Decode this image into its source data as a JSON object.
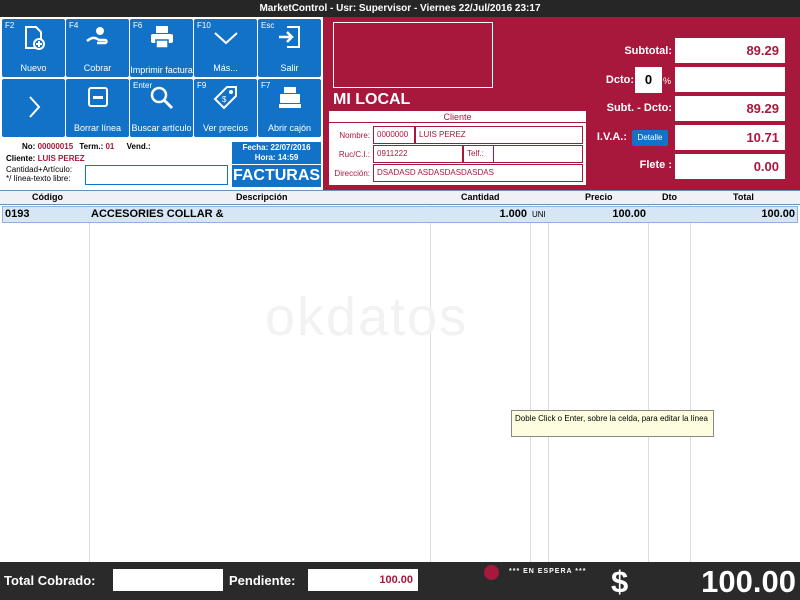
{
  "window": {
    "title": "MarketControl - Usr: Supervisor - Viernes 22/Jul/2016  23:17"
  },
  "toolbar": {
    "buttons": [
      {
        "fkey": "F2",
        "label": "Nuevo",
        "icon": "new-document-icon"
      },
      {
        "fkey": "F4",
        "label": "Cobrar",
        "icon": "hand-coin-icon"
      },
      {
        "fkey": "F6",
        "label": "Imprimir factura",
        "icon": "printer-icon"
      },
      {
        "fkey": "F10",
        "label": "Más...",
        "icon": "chevron-down-icon"
      },
      {
        "fkey": "Esc",
        "label": "Salir",
        "icon": "exit-icon"
      },
      {
        "fkey": "",
        "label": "",
        "icon": "chevron-right-icon"
      },
      {
        "fkey": "",
        "label": "Borrar línea",
        "icon": "delete-line-icon"
      },
      {
        "fkey": "Enter",
        "label": "Buscar artículo",
        "icon": "search-icon"
      },
      {
        "fkey": "F9",
        "label": "Ver precios",
        "icon": "price-tag-icon"
      },
      {
        "fkey": "F7",
        "label": "Abrir cajón",
        "icon": "cash-register-icon"
      }
    ]
  },
  "invoice": {
    "no_label": "No:",
    "no_value": "00000015",
    "term_label": "Term.:",
    "term_value": "01",
    "vend_label": "Vend.:",
    "cliente_label": "Cliente:",
    "cliente_value": "LUIS PEREZ",
    "cantidad_label": "Cantidad+Artículo:",
    "linea_label": "*/ línea-texto libre:",
    "fecha": "Fecha: 22/07/2016",
    "hora": "Hora: 14:59",
    "doc_type": "FACTURAS"
  },
  "store": {
    "name": "MI LOCAL"
  },
  "cliente": {
    "title": "Cliente",
    "nombre_label": "Nombre:",
    "codigo": "0000000",
    "nombre": "LUIS PEREZ",
    "ruc_label": "Ruc/C.I.:",
    "ruc": "0911222",
    "telf_label": "Telf.:",
    "telf": "",
    "direccion_label": "Dirección:",
    "direccion": "DSADASD ASDASDASDASDAS"
  },
  "totals": {
    "subtotal_label": "Subtotal:",
    "subtotal": "89.29",
    "dcto_label": "Dcto:",
    "dcto": "0",
    "pct": "%",
    "subt_dcto_label": "Subt. - Dcto:",
    "subt_dcto": "89.29",
    "iva_label": "I.V.A.:",
    "detalle": "Detalle",
    "iva": "10.71",
    "flete_label": "Flete :",
    "flete": "0.00"
  },
  "grid": {
    "columns": [
      "Código",
      "Descripción",
      "Cantidad",
      "Precio",
      "Dto",
      "Total"
    ],
    "rows": [
      {
        "codigo": "0193",
        "descripcion": "ACCESORIES COLLAR &",
        "cantidad": "1.000",
        "unidad": "UNI",
        "precio": "100.00",
        "dto": "",
        "total": "100.00"
      }
    ],
    "watermark": "okdatos",
    "tooltip": "Doble Click o Enter, sobre la celda, para editar la línea"
  },
  "footer": {
    "cobrado_label": "Total Cobrado:",
    "cobrado": "",
    "pendiente_label": "Pendiente:",
    "pendiente": "100.00",
    "espera": "*** EN ESPERA ***",
    "currency": "$",
    "total": "100.00"
  }
}
